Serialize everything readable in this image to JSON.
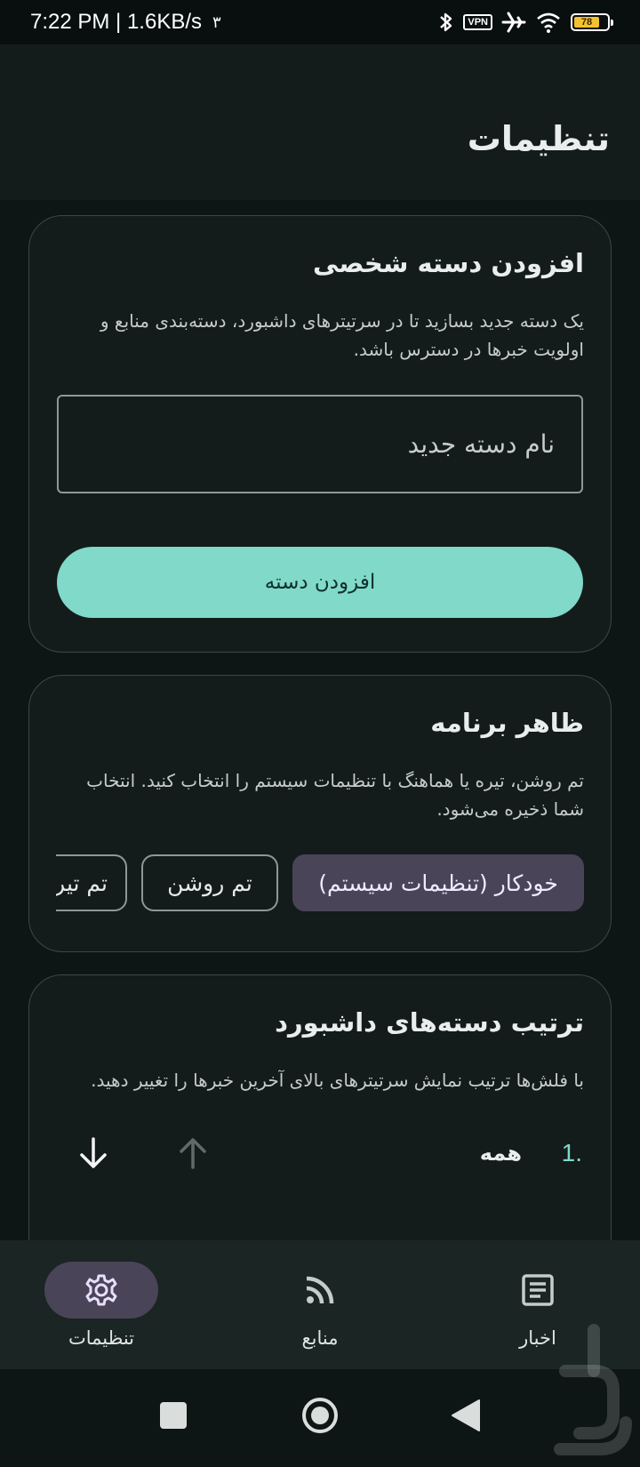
{
  "status_bar": {
    "time_speed": "7:22 PM | 1.6KB/s",
    "extra": "٣",
    "vpn_label": "VPN",
    "battery_level": "78"
  },
  "app_bar": {
    "title": "تنظیمات"
  },
  "add_category_card": {
    "title": "افزودن دسته شخصی",
    "description": "یک دسته جدید بسازید تا در سرتیترهای داشبورد، دسته‌بندی منابع و اولویت خبرها در دسترس باشد.",
    "input_value": "",
    "input_placeholder": "نام دسته جدید",
    "add_button_label": "افزودن دسته"
  },
  "appearance_card": {
    "title": "ظاهر برنامه",
    "description": "تم روشن، تیره یا هماهنگ با تنظیمات سیستم را انتخاب کنید. انتخاب شما ذخیره می‌شود.",
    "options": [
      {
        "label": "خودکار (تنظیمات سیستم)",
        "selected": true
      },
      {
        "label": "تم روشن",
        "selected": false
      },
      {
        "label": "تم تیره",
        "selected": false
      }
    ]
  },
  "ordering_card": {
    "title": "ترتیب دسته‌های داشبورد",
    "description": "با فلش‌ها ترتیب نمایش سرتیترهای بالای آخرین خبرها را تغییر دهید.",
    "items": [
      {
        "number": "1.",
        "label": "همه"
      }
    ]
  },
  "bottom_nav": {
    "items": [
      {
        "label": "تنظیمات",
        "icon": "gear-icon",
        "active": true
      },
      {
        "label": "منابع",
        "icon": "rss-icon",
        "active": false
      },
      {
        "label": "اخبار",
        "icon": "article-icon",
        "active": false
      }
    ]
  },
  "colors": {
    "accent": "#80d9c9",
    "selected_chip": "#4a4458",
    "surface": "#131c1b",
    "background": "#0e1615"
  }
}
